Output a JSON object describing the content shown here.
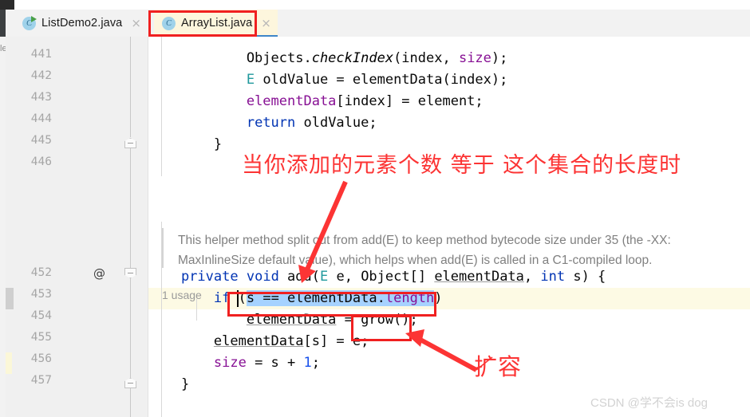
{
  "window": {
    "edge_fragment_text": "le"
  },
  "tabs": [
    {
      "label": "ListDemo2.java",
      "icon": "java-class-icon",
      "close_glyph": "×",
      "icon_letter": "C",
      "active": false,
      "has_run_flag": true
    },
    {
      "label": "ArrayList.java",
      "icon": "java-class-icon",
      "close_glyph": "×",
      "icon_letter": "C",
      "active": true,
      "has_run_flag": false
    }
  ],
  "gutter": {
    "line_numbers": [
      "441",
      "442",
      "443",
      "444",
      "445",
      "446",
      "452",
      "453",
      "454",
      "455",
      "456",
      "457"
    ],
    "annotation_marker": "@",
    "annotation_marker_line": "452",
    "highlighted_line": "453"
  },
  "code": {
    "lines": [
      {
        "number": "441",
        "tokens": [
          {
            "text": "            Objects.",
            "cls": ""
          },
          {
            "text": "checkIndex",
            "cls": "mth"
          },
          {
            "text": "(index, ",
            "cls": ""
          },
          {
            "text": "size",
            "cls": "field"
          },
          {
            "text": ");",
            "cls": ""
          }
        ]
      },
      {
        "number": "442",
        "tokens": [
          {
            "text": "            ",
            "cls": ""
          },
          {
            "text": "E",
            "cls": "typ"
          },
          {
            "text": " oldValue = elementData(index);",
            "cls": ""
          }
        ]
      },
      {
        "number": "443",
        "tokens": [
          {
            "text": "            ",
            "cls": ""
          },
          {
            "text": "elementData",
            "cls": "field"
          },
          {
            "text": "[index] = element;",
            "cls": ""
          }
        ]
      },
      {
        "number": "444",
        "tokens": [
          {
            "text": "            ",
            "cls": ""
          },
          {
            "text": "return",
            "cls": "kw"
          },
          {
            "text": " oldValue;",
            "cls": ""
          }
        ]
      },
      {
        "number": "445",
        "tokens": [
          {
            "text": "        }",
            "cls": ""
          }
        ]
      },
      {
        "number": "452",
        "tokens": [
          {
            "text": "    ",
            "cls": ""
          },
          {
            "text": "private",
            "cls": "kw"
          },
          {
            "text": " ",
            "cls": ""
          },
          {
            "text": "void",
            "cls": "kw"
          },
          {
            "text": " add(",
            "cls": ""
          },
          {
            "text": "E",
            "cls": "typ"
          },
          {
            "text": " e, Object[] ",
            "cls": ""
          },
          {
            "text": "elementData",
            "cls": "und"
          },
          {
            "text": ", ",
            "cls": ""
          },
          {
            "text": "int",
            "cls": "kw"
          },
          {
            "text": " s) {",
            "cls": ""
          }
        ]
      },
      {
        "number": "453",
        "tokens": [
          {
            "text": "        ",
            "cls": ""
          },
          {
            "text": "if",
            "cls": "kw"
          },
          {
            "text": " (",
            "cls": ""
          },
          {
            "text": "s == elementData.",
            "cls": "sel"
          },
          {
            "text": "length",
            "cls": "sel field"
          },
          {
            "text": ")",
            "cls": ""
          }
        ]
      },
      {
        "number": "454",
        "tokens": [
          {
            "text": "            ",
            "cls": ""
          },
          {
            "text": "elementData",
            "cls": "und"
          },
          {
            "text": " = grow();",
            "cls": ""
          }
        ]
      },
      {
        "number": "455",
        "tokens": [
          {
            "text": "        ",
            "cls": ""
          },
          {
            "text": "elementData",
            "cls": "und"
          },
          {
            "text": "[s] = e;",
            "cls": ""
          }
        ]
      },
      {
        "number": "456",
        "tokens": [
          {
            "text": "        ",
            "cls": ""
          },
          {
            "text": "size",
            "cls": "field"
          },
          {
            "text": " = s + ",
            "cls": ""
          },
          {
            "text": "1",
            "cls": "num"
          },
          {
            "text": ";",
            "cls": ""
          }
        ]
      },
      {
        "number": "457",
        "tokens": [
          {
            "text": "    }",
            "cls": ""
          }
        ]
      }
    ],
    "javadoc": [
      "This helper method split out from add(E) to keep method bytecode size under 35 (the -XX:",
      "MaxInlineSize default value), which helps when add(E) is called in a C1-compiled loop."
    ],
    "usage_hint": "1 usage"
  },
  "annotations": {
    "main_note": "当你添加的元素个数 等于 这个集合的长度时",
    "grow_note": "扩容",
    "color": "#fc3434",
    "box_color": "#f02020"
  },
  "watermark": {
    "text": "CSDN @学不会is dog"
  },
  "colors": {
    "tab_active_bg": "#fdf6dd",
    "tab_active_underline": "#3e86c9",
    "selection": "#a6d2ff",
    "highlight_row": "#fdfae4",
    "keyword": "#0033b3",
    "field": "#871094",
    "type": "#20999d",
    "number": "#1750eb"
  }
}
